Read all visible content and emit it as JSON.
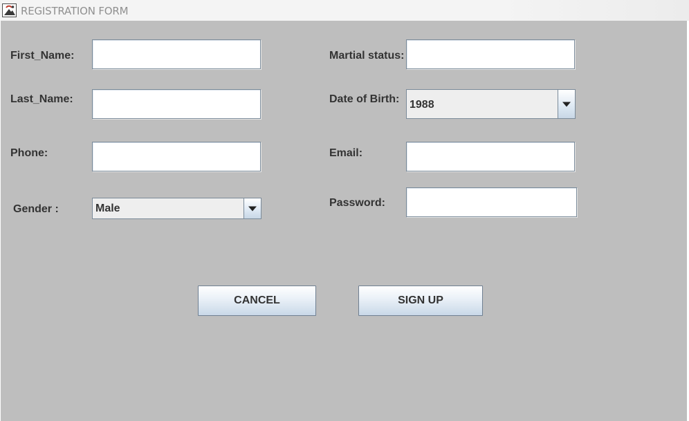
{
  "window": {
    "title": "REGISTRATION FORM"
  },
  "form": {
    "first_name": {
      "label": "First_Name:",
      "value": ""
    },
    "last_name": {
      "label": "Last_Name:",
      "value": ""
    },
    "phone": {
      "label": "Phone:",
      "value": ""
    },
    "gender": {
      "label": "Gender :",
      "selected": "Male"
    },
    "marital_status": {
      "label": "Martial status:",
      "value": ""
    },
    "date_of_birth": {
      "label": "Date of Birth:",
      "selected": "1988"
    },
    "email": {
      "label": "Email:",
      "value": ""
    },
    "password": {
      "label": "Password:",
      "value": ""
    }
  },
  "buttons": {
    "cancel": "CANCEL",
    "sign_up": "SIGN UP"
  },
  "icons": {
    "app": "java-app-icon",
    "dropdown": "chevron-down-icon"
  },
  "colors": {
    "panel_background": "#bebebe",
    "titlebar_background": "#f4f4f4",
    "title_text": "#909090",
    "label_text": "#333333"
  }
}
